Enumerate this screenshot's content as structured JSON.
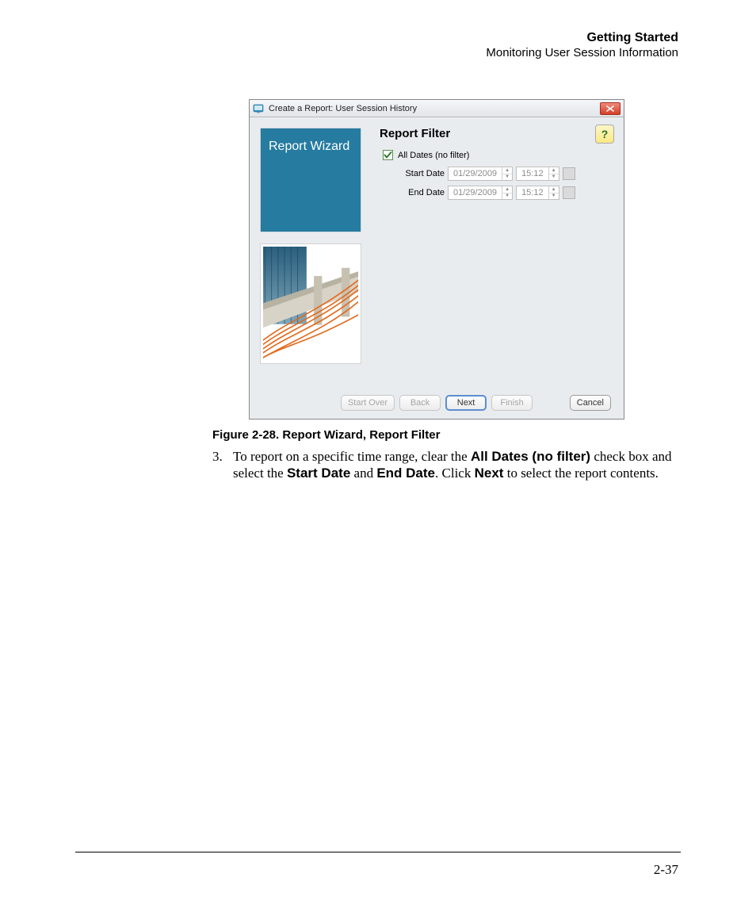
{
  "header": {
    "title": "Getting Started",
    "subtitle": "Monitoring User Session Information"
  },
  "dialog": {
    "window_title": "Create a Report: User Session History",
    "left_panel_title": "Report Wizard",
    "section_title": "Report Filter",
    "help_glyph": "?",
    "checkbox_label": "All Dates (no filter)",
    "start_label": "Start Date",
    "end_label": "End Date",
    "start_date": "01/29/2009",
    "start_time": "15:12",
    "end_date": "01/29/2009",
    "end_time": "15:12",
    "buttons": {
      "start_over": "Start Over",
      "back": "Back",
      "next": "Next",
      "finish": "Finish",
      "cancel": "Cancel"
    }
  },
  "caption": "Figure 2-28. Report Wizard, Report Filter",
  "instruction": {
    "number": "3.",
    "pre": "To report on a specific time range, clear the ",
    "b1": "All Dates (no filter)",
    "mid1": " check box and select the ",
    "b2": "Start Date",
    "mid2": " and ",
    "b3": "End Date",
    "mid3": ". Click ",
    "b4": "Next",
    "post": " to select the report contents."
  },
  "page_number": "2-37"
}
